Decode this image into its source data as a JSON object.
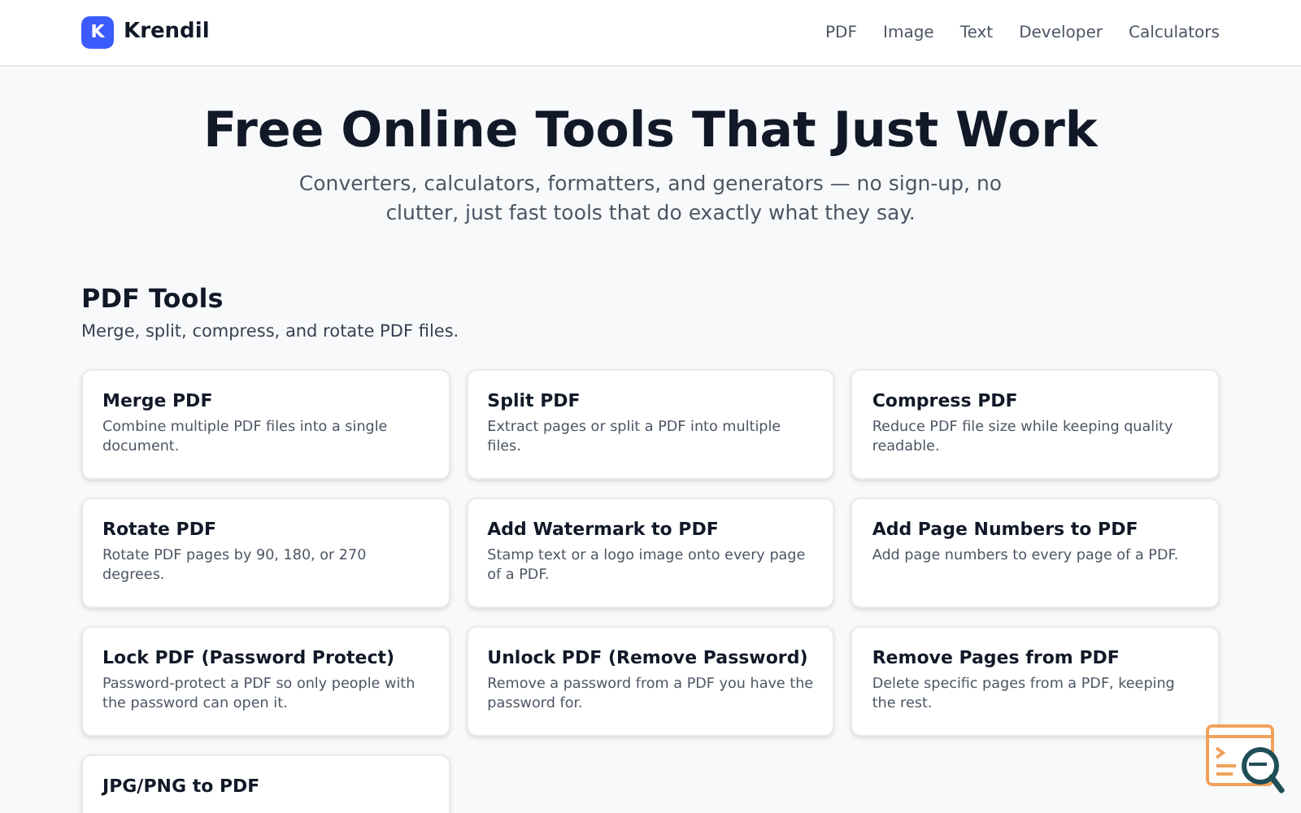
{
  "header": {
    "logo_letter": "K",
    "brand": "Krendil",
    "nav": [
      "PDF",
      "Image",
      "Text",
      "Developer",
      "Calculators"
    ]
  },
  "hero": {
    "title": "Free Online Tools That Just Work",
    "subtitle": "Converters, calculators, formatters, and generators — no sign-up, no clutter, just fast tools that do exactly what they say."
  },
  "section": {
    "title": "PDF Tools",
    "subtitle": "Merge, split, compress, and rotate PDF files.",
    "tools": [
      {
        "title": "Merge PDF",
        "description": "Combine multiple PDF files into a single document."
      },
      {
        "title": "Split PDF",
        "description": "Extract pages or split a PDF into multiple files."
      },
      {
        "title": "Compress PDF",
        "description": "Reduce PDF file size while keeping quality readable."
      },
      {
        "title": "Rotate PDF",
        "description": "Rotate PDF pages by 90, 180, or 270 degrees."
      },
      {
        "title": "Add Watermark to PDF",
        "description": "Stamp text or a logo image onto every page of a PDF."
      },
      {
        "title": "Add Page Numbers to PDF",
        "description": "Add page numbers to every page of a PDF."
      },
      {
        "title": "Lock PDF (Password Protect)",
        "description": "Password-protect a PDF so only people with the password can open it."
      },
      {
        "title": "Unlock PDF (Remove Password)",
        "description": "Remove a password from a PDF you have the password for."
      },
      {
        "title": "Remove Pages from PDF",
        "description": "Delete specific pages from a PDF, keeping the rest."
      },
      {
        "title": "JPG/PNG to PDF"
      }
    ]
  }
}
